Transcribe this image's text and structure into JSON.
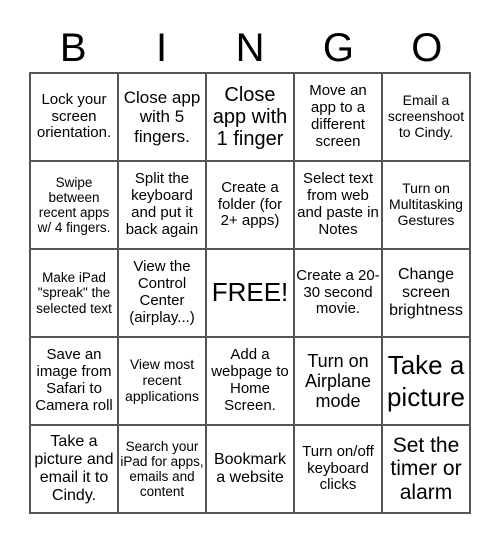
{
  "header": {
    "letters": [
      "B",
      "I",
      "N",
      "G",
      "O"
    ]
  },
  "cells": [
    {
      "text": "Lock your screen orientation.",
      "size": "s15"
    },
    {
      "text": "Close app with 5 fingers.",
      "size": "s17"
    },
    {
      "text": "Close app with 1 finger",
      "size": "s20"
    },
    {
      "text": "Move an app to a different screen",
      "size": "s15"
    },
    {
      "text": "Email a screenshoot to Cindy.",
      "size": "s14"
    },
    {
      "text": "Swipe between recent apps w/ 4 fingers.",
      "size": "s13"
    },
    {
      "text": "Split the keyboard and put it back again",
      "size": "s15"
    },
    {
      "text": "Create a folder (for 2+ apps)",
      "size": "s15"
    },
    {
      "text": "Select text from web and paste in Notes",
      "size": "s15"
    },
    {
      "text": "Turn on Multitasking Gestures",
      "size": "s14"
    },
    {
      "text": "Make iPad \"spreak\" the selected text",
      "size": "s13"
    },
    {
      "text": "View the Control Center (airplay...)",
      "size": "s15"
    },
    {
      "text": "FREE!",
      "size": "s26"
    },
    {
      "text": "Create a 20-30 second movie.",
      "size": "s15"
    },
    {
      "text": "Change screen brightness",
      "size": "s16"
    },
    {
      "text": "Save an image from Safari to Camera roll",
      "size": "s15"
    },
    {
      "text": "View most recent applications",
      "size": "s14"
    },
    {
      "text": "Add a webpage to Home Screen.",
      "size": "s15"
    },
    {
      "text": "Turn on Airplane mode",
      "size": "s18"
    },
    {
      "text": "Take a picture",
      "size": "s28"
    },
    {
      "text": "Take a picture and email it to Cindy.",
      "size": "s16"
    },
    {
      "text": "Search your iPad for apps, emails and content",
      "size": "s13"
    },
    {
      "text": "Bookmark a website",
      "size": "s16"
    },
    {
      "text": "Turn on/off keyboard clicks",
      "size": "s15"
    },
    {
      "text": "Set the timer or alarm",
      "size": "s21"
    }
  ]
}
